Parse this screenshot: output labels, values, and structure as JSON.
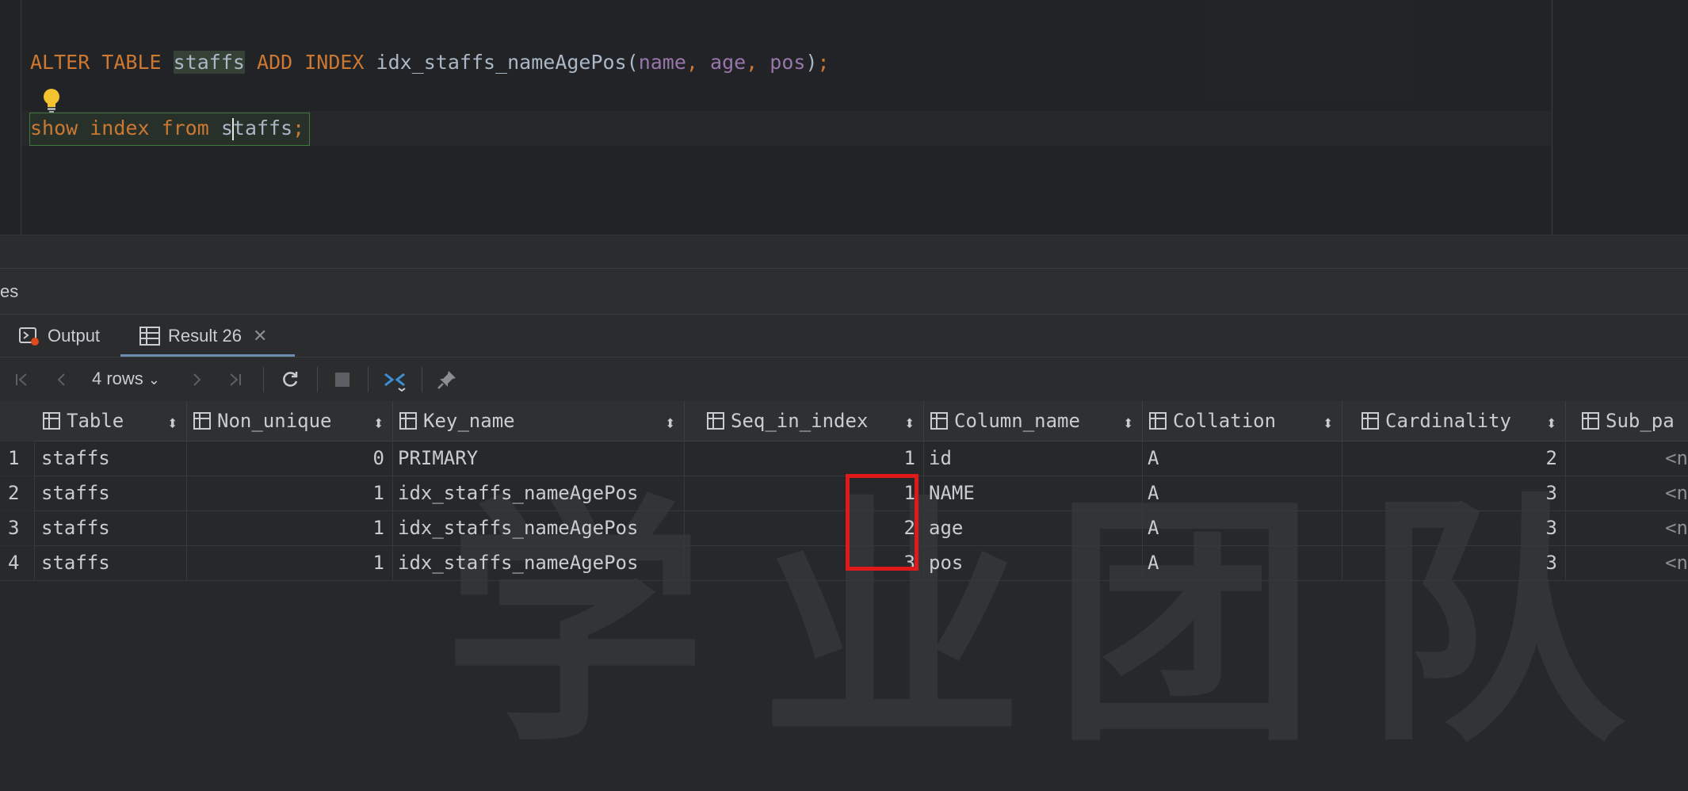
{
  "editor": {
    "line1": {
      "kw1": "ALTER TABLE",
      "table": "staffs",
      "kw2": "ADD INDEX",
      "index_name": "idx_staffs_nameAgePos",
      "open": "(",
      "c1": "name",
      "sep1": ", ",
      "c2": "age",
      "sep2": ", ",
      "c3": "pos",
      "close": ")",
      "semi": ";"
    },
    "line2": {
      "kw": "show index from",
      "table_pre": "s",
      "table_post": "taffs",
      "semi": ";"
    }
  },
  "services": {
    "label": "es"
  },
  "tabs": [
    {
      "label": "Output",
      "icon": "output-icon"
    },
    {
      "label": "Result 26",
      "icon": "table-icon"
    }
  ],
  "toolbar": {
    "rows_label": "4 rows"
  },
  "grid": {
    "columns": [
      "Table",
      "Non_unique",
      "Key_name",
      "Seq_in_index",
      "Column_name",
      "Collation",
      "Cardinality",
      "Sub_pa"
    ],
    "rows": [
      {
        "n": "1",
        "table": "staffs",
        "non_unique": "0",
        "key_name": "PRIMARY",
        "seq": "1",
        "column_name": "id",
        "collation": "A",
        "cardinality": "2",
        "sub_part": "<n"
      },
      {
        "n": "2",
        "table": "staffs",
        "non_unique": "1",
        "key_name": "idx_staffs_nameAgePos",
        "seq": "1",
        "column_name": "NAME",
        "collation": "A",
        "cardinality": "3",
        "sub_part": "<n"
      },
      {
        "n": "3",
        "table": "staffs",
        "non_unique": "1",
        "key_name": "idx_staffs_nameAgePos",
        "seq": "2",
        "column_name": "age",
        "collation": "A",
        "cardinality": "3",
        "sub_part": "<n"
      },
      {
        "n": "4",
        "table": "staffs",
        "non_unique": "1",
        "key_name": "idx_staffs_nameAgePos",
        "seq": "3",
        "column_name": "pos",
        "collation": "A",
        "cardinality": "3",
        "sub_part": "<n"
      }
    ]
  },
  "colors": {
    "highlight_box": "#e0191b",
    "keyword": "#cc7832",
    "column_ident": "#9876aa"
  }
}
